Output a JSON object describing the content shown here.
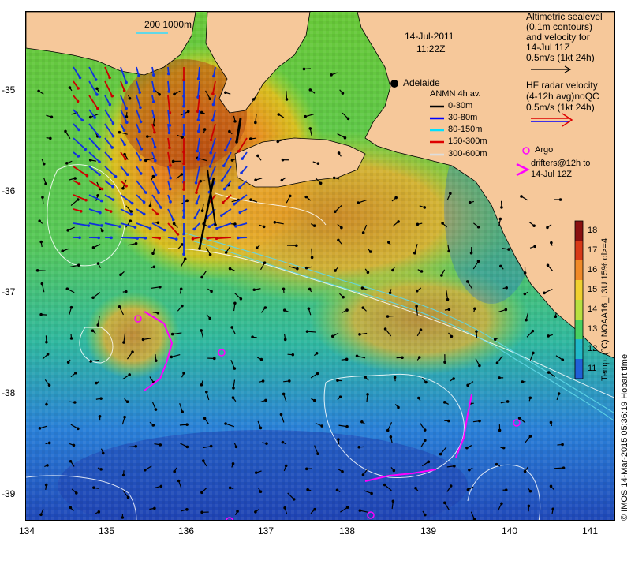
{
  "title": {
    "date": "14-Jul-2011",
    "time": "11:22Z"
  },
  "scale_bar": {
    "label": "200  1000m"
  },
  "city": {
    "name": "Adelaide"
  },
  "altimetry_note": [
    "Altimetric sealevel",
    "(0.1m contours)",
    "and velocity for",
    "14-Jul 11Z",
    "0.5m/s (1kt 24h)"
  ],
  "radar_note": [
    "HF radar velocity",
    "(4-12h avg)",
    "0.5m/s (1kt 24h)"
  ],
  "radar_qc": "noQC",
  "anmn_legend": {
    "title": "ANMN 4h av.",
    "items": [
      {
        "label": "0-30m",
        "color": "#000000"
      },
      {
        "label": "30-80m",
        "color": "#0000ff"
      },
      {
        "label": "80-150m",
        "color": "#00e0ff"
      },
      {
        "label": "150-300m",
        "color": "#dd0000"
      },
      {
        "label": "300-600m",
        "color": "#dddddd"
      }
    ]
  },
  "argo_legend": {
    "label": "Argo",
    "color": "#ff00ff"
  },
  "drifter_legend": {
    "label": [
      "drifters@12h to",
      "14-Jul 12Z"
    ],
    "color": "#ff00ff"
  },
  "x_axis": {
    "ticks": [
      "134",
      "135",
      "136",
      "137",
      "138",
      "139",
      "140",
      "141"
    ]
  },
  "y_axis": {
    "ticks": [
      "-35",
      "-36",
      "-37",
      "-38",
      "-39"
    ]
  },
  "colorbar": {
    "ticks": [
      "18",
      "17",
      "16",
      "15",
      "14",
      "13",
      "12",
      "11"
    ],
    "label": "Temp. (°C) NOAA16_L3U 15% ql>=4"
  },
  "credit": "© IMOS 14-Mar-2015 05:36:19 Hobart time",
  "colors": {
    "land": "#f6c89a",
    "sea_warm": "#e07820",
    "sea_mid": "#60d040",
    "sea_cool": "#2a60d0",
    "drifter": "#ff00ff"
  }
}
